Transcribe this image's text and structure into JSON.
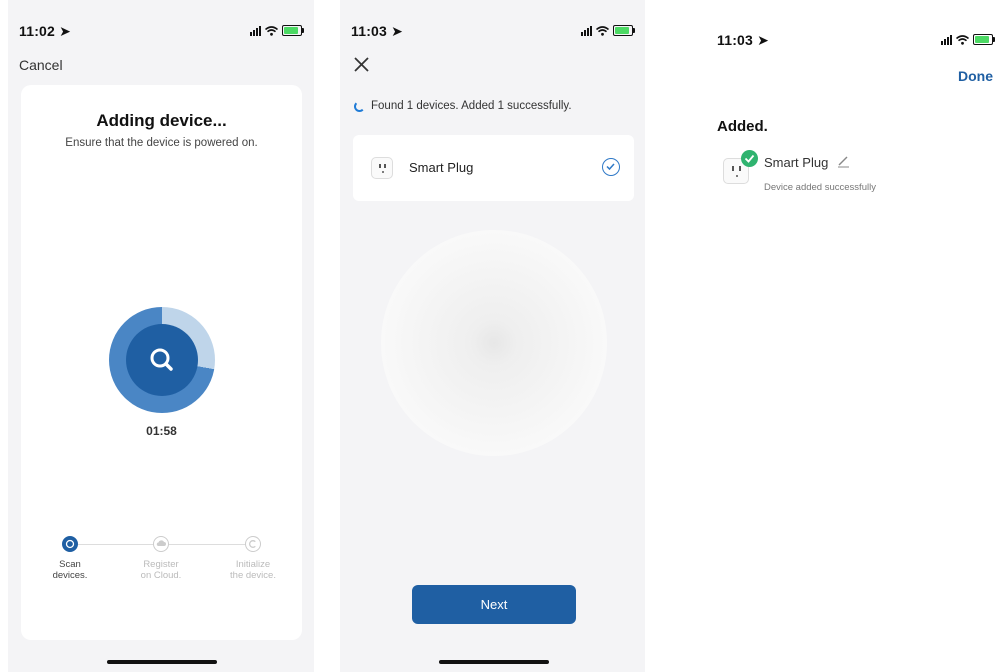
{
  "screen1": {
    "time": "11:02",
    "cancel_label": "Cancel",
    "title": "Adding device...",
    "subtitle": "Ensure that the device is powered on.",
    "timer": "01:58",
    "scan_progress": 0.72,
    "steps": [
      {
        "label": "Scan\ndevices.",
        "active": true
      },
      {
        "label": "Register\non Cloud.",
        "active": false
      },
      {
        "label": "Initialize\nthe device.",
        "active": false
      }
    ]
  },
  "screen2": {
    "time": "11:03",
    "found_text": "Found 1 devices. Added 1 successfully.",
    "device_name": "Smart Plug",
    "next_label": "Next"
  },
  "screen3": {
    "time": "11:03",
    "done_label": "Done",
    "added_heading": "Added.",
    "device_name": "Smart Plug",
    "status_text": "Device added successfully"
  },
  "colors": {
    "primary": "#1f5fa3",
    "success": "#2fb36f",
    "battery": "#4cd964"
  },
  "icons": [
    "location-arrow-icon",
    "signal-icon",
    "wifi-icon",
    "battery-icon",
    "search-icon",
    "close-icon",
    "spinner-icon",
    "plug-icon",
    "check-circle-icon",
    "check-icon",
    "pencil-icon"
  ]
}
